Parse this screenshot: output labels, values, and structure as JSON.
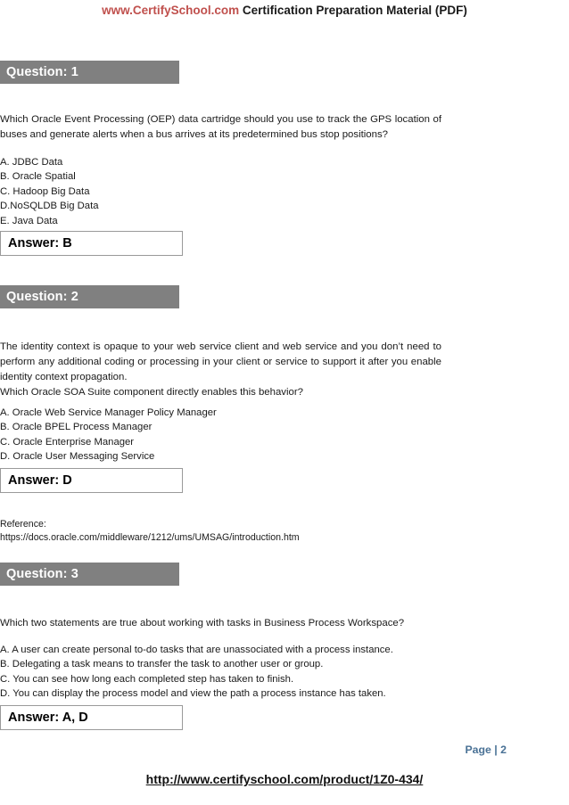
{
  "header": {
    "brand": "www.CertifySchool.com",
    "title": " Certification Preparation Material (PDF)"
  },
  "questions": [
    {
      "bar_label": "Question: 1",
      "text": "Which Oracle Event Processing (OEP) data cartridge should you use to track the GPS location of buses and generate alerts when a bus arrives at its predetermined bus stop positions?",
      "options": [
        "A. JDBC Data",
        "B. Oracle Spatial",
        "C. Hadoop Big Data",
        "D.NoSQLDB Big Data",
        "E. Java Data"
      ],
      "answer_label": "Answer: B"
    },
    {
      "bar_label": "Question: 2",
      "text": "The identity context is opaque to your web service client and web service and you don’t need to perform any additional coding or processing in your client or service to support it after you enable identity context propagation.",
      "text_line2": "Which Oracle SOA Suite component directly enables this behavior?",
      "options": [
        "A. Oracle Web Service Manager Policy Manager",
        "B. Oracle BPEL Process Manager",
        "C. Oracle Enterprise Manager",
        "D. Oracle User Messaging Service"
      ],
      "answer_label": "Answer: D",
      "reference_label": "Reference:",
      "reference_url": "https://docs.oracle.com/middleware/1212/ums/UMSAG/introduction.htm"
    },
    {
      "bar_label": "Question: 3",
      "text": "Which two statements are true about working with tasks in Business Process Workspace?",
      "options": [
        "A. A user can create personal to-do tasks that are unassociated with a process instance.",
        "B. Delegating a task means to transfer the task to another user or group.",
        "C. You can see how long each completed step has taken to finish.",
        "D. You can display the process model and view the path a process instance has taken."
      ],
      "answer_label": "Answer: A, D"
    }
  ],
  "footer": {
    "page_number": "Page | 2",
    "url": "http://www.certifyschool.com/product/1Z0-434/"
  },
  "colors": {
    "brand_red": "#C0504D",
    "question_bar_gray": "#808080",
    "page_number_blue": "#4A7296",
    "answer_border": "#9a9a9a"
  }
}
